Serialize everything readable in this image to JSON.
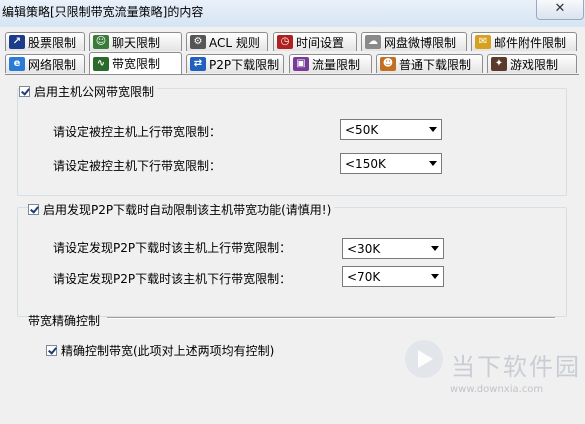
{
  "window": {
    "title": "编辑策略[只限制带宽流量策略]的内容",
    "close_glyph": "✕"
  },
  "tabs_row1": [
    {
      "label": "股票限制",
      "icon": "stock-chart-icon",
      "color": "#1c3b8a"
    },
    {
      "label": "聊天限制",
      "icon": "chat-people-icon",
      "color": "#3a7a3a"
    },
    {
      "label": "ACL 规则",
      "icon": "acl-gear-icon",
      "color": "#555555"
    },
    {
      "label": "时间设置",
      "icon": "clock-icon",
      "color": "#b02020"
    },
    {
      "label": "网盘微博限制",
      "icon": "cloud-disk-icon",
      "color": "#8a8a8a"
    },
    {
      "label": "邮件附件限制",
      "icon": "mail-attachment-icon",
      "color": "#d8a020"
    }
  ],
  "tabs_row2": [
    {
      "label": "网络限制",
      "icon": "ie-globe-icon",
      "color": "#2a7ad8",
      "active": false
    },
    {
      "label": "带宽限制",
      "icon": "bandwidth-monitor-icon",
      "color": "#2a6a2a",
      "active": true
    },
    {
      "label": "P2P下载限制",
      "icon": "p2p-download-icon",
      "color": "#2060c0",
      "active": false
    },
    {
      "label": "流量限制",
      "icon": "traffic-box-icon",
      "color": "#7a3a9a",
      "active": false
    },
    {
      "label": "普通下载限制",
      "icon": "download-user-icon",
      "color": "#c07020",
      "active": false
    },
    {
      "label": "游戏限制",
      "icon": "game-controller-icon",
      "color": "#5a3a2a",
      "active": false
    }
  ],
  "host_bandwidth": {
    "checkbox_label": "启用主机公网带宽限制",
    "upload_label": "请设定被控主机上行带宽限制：",
    "upload_value": "<50K",
    "download_label": "请设定被控主机下行带宽限制：",
    "download_value": "<150K"
  },
  "p2p_auto": {
    "checkbox_label": "启用发现P2P下载时自动限制该主机带宽功能(请慎用!)",
    "upload_label": "请设定发现P2P下载时该主机上行带宽限制：",
    "upload_value": "<30K",
    "download_label": "请设定发现P2P下载时该主机下行带宽限制：",
    "download_value": "<70K"
  },
  "precise": {
    "section_title": "带宽精确控制",
    "checkbox_label": "精确控制带宽(此项对上述两项均有控制)"
  },
  "watermark": {
    "name": "当下软件园",
    "url": "www.downxia.com"
  }
}
